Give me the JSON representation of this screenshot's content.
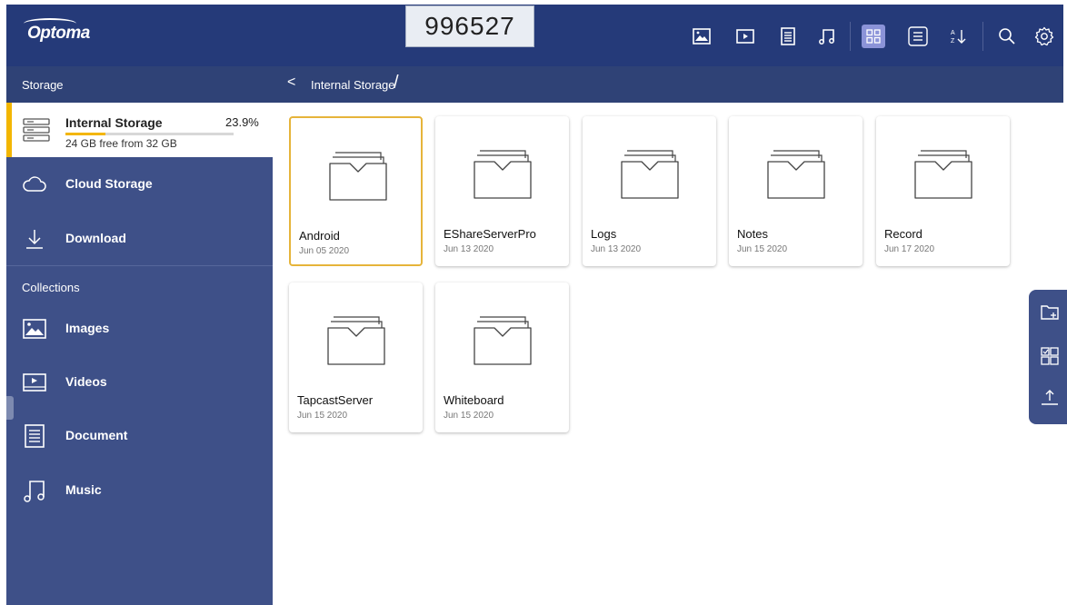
{
  "brand": {
    "logo_text": "Optoma"
  },
  "header": {
    "code": "996527"
  },
  "toolbar": {
    "icons": [
      "image-filter-icon",
      "video-filter-icon",
      "document-filter-icon",
      "music-filter-icon",
      "grid-view-icon",
      "list-view-icon",
      "sort-az-icon",
      "search-icon",
      "settings-icon"
    ],
    "active_view": "grid-view-icon",
    "accent_color": "#8b93d8",
    "bar_color": "#253a79"
  },
  "breadcrumb": {
    "back_symbol": "<",
    "path": "Internal Storage",
    "separator": "/"
  },
  "sidebar": {
    "storage_header": "Storage",
    "internal_storage": {
      "label": "Internal Storage",
      "percent": "23.9%",
      "usage_fraction": 0.239,
      "free_text": "24 GB free from 32 GB"
    },
    "storage_items": [
      {
        "label": "Cloud Storage",
        "icon": "cloud-icon"
      },
      {
        "label": "Download",
        "icon": "download-icon"
      }
    ],
    "collections_header": "Collections",
    "collection_items": [
      {
        "label": "Images",
        "icon": "image-icon"
      },
      {
        "label": "Videos",
        "icon": "video-icon"
      },
      {
        "label": "Document",
        "icon": "document-icon"
      },
      {
        "label": "Music",
        "icon": "music-icon"
      }
    ],
    "accent_color": "#f3b600"
  },
  "folders": [
    {
      "name": "Android",
      "date": "Jun 05 2020",
      "selected": true
    },
    {
      "name": "EShareServerPro",
      "date": "Jun 13 2020",
      "selected": false
    },
    {
      "name": "Logs",
      "date": "Jun 13 2020",
      "selected": false
    },
    {
      "name": "Notes",
      "date": "Jun 15 2020",
      "selected": false
    },
    {
      "name": "Record",
      "date": "Jun 17 2020",
      "selected": false
    },
    {
      "name": "TapcastServer",
      "date": "Jun 15 2020",
      "selected": false
    },
    {
      "name": "Whiteboard",
      "date": "Jun 15 2020",
      "selected": false
    }
  ],
  "floating_actions": [
    "new-folder-icon",
    "multi-select-icon",
    "upload-icon"
  ]
}
